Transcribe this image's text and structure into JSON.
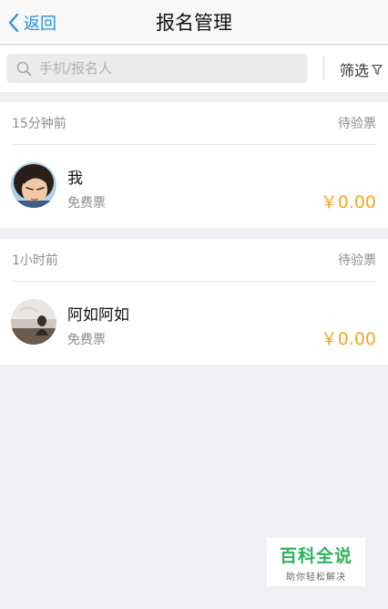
{
  "navbar": {
    "back_label": "返回",
    "title": "报名管理"
  },
  "search": {
    "placeholder": "手机/报名人",
    "value": "",
    "filter_label": "筛选"
  },
  "groups": [
    {
      "time": "15分钟前",
      "status": "待验票",
      "entry": {
        "name": "我",
        "ticket_type": "免费票",
        "price": "￥0.00",
        "avatar": "avatar-cartoon-icon"
      }
    },
    {
      "time": "1小时前",
      "status": "待验票",
      "entry": {
        "name": "阿如阿如",
        "ticket_type": "免费票",
        "price": "￥0.00",
        "avatar": "avatar-photo-icon"
      }
    }
  ],
  "watermark": {
    "title": "百科全说",
    "subtitle": "助你轻松解决"
  },
  "colors": {
    "accent_blue": "#2a8fe0",
    "price_orange": "#f5a623",
    "background": "#efeff4",
    "watermark_green": "#2db35a"
  }
}
